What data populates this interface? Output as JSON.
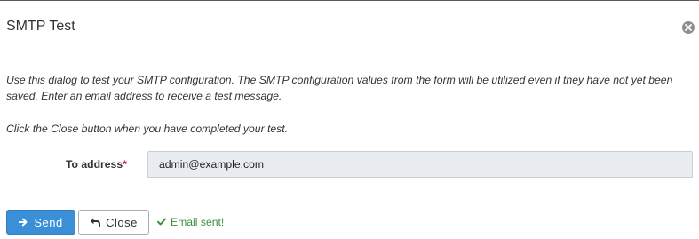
{
  "dialog": {
    "title": "SMTP Test",
    "description": "Use this dialog to test your SMTP configuration. The SMTP configuration values from the form will be utilized even if they have not yet been saved. Enter an email address to receive a test message.",
    "instruction": "Click the Close button when you have completed your test."
  },
  "form": {
    "to_address_label": "To address",
    "required_marker": "*",
    "to_address_value": "admin@example.com"
  },
  "actions": {
    "send_label": "Send",
    "close_label": "Close"
  },
  "status": {
    "message": "Email sent!",
    "color": "#3c8f3c"
  },
  "colors": {
    "primary_button": "#3a8fd6",
    "input_background": "#e9edf2",
    "required": "#c7254e"
  },
  "icons": {
    "dialog_close": "close-circle-icon",
    "send": "arrow-right-icon",
    "close": "reply-arrow-icon",
    "status": "check-icon"
  }
}
